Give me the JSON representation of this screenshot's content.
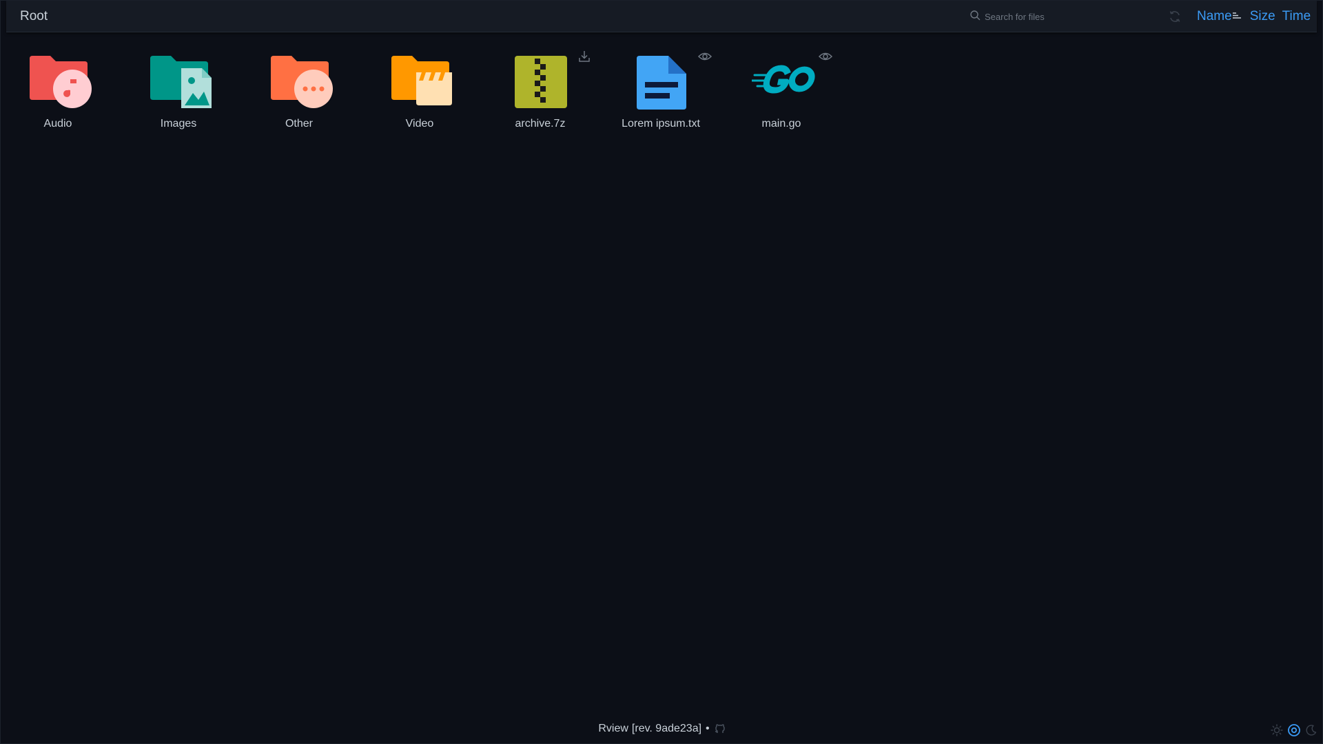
{
  "header": {
    "breadcrumb": "Root",
    "search_placeholder": "Search for files",
    "sort": {
      "name_label": "Name",
      "size_label": "Size",
      "time_label": "Time",
      "active": "name"
    }
  },
  "entries": [
    {
      "name": "Audio",
      "kind": "folder",
      "icon": "folder-audio-icon",
      "color": "#ef5350",
      "badge_color": "#ffcdd2"
    },
    {
      "name": "Images",
      "kind": "folder",
      "icon": "folder-images-icon",
      "color": "#009688",
      "badge_color": "#b2dfdb"
    },
    {
      "name": "Other",
      "kind": "folder",
      "icon": "folder-other-icon",
      "color": "#ff7043",
      "badge_color": "#ffccbc"
    },
    {
      "name": "Video",
      "kind": "folder",
      "icon": "folder-video-icon",
      "color": "#ff9800",
      "badge_color": "#ffe0b2"
    },
    {
      "name": "archive.7z",
      "kind": "file",
      "icon": "zip-file-icon",
      "color": "#afb42b",
      "action": "download-icon"
    },
    {
      "name": "Lorem ipsum.txt",
      "kind": "file",
      "icon": "text-file-icon",
      "color": "#42a5f5",
      "action": "preview-eye-icon"
    },
    {
      "name": "main.go",
      "kind": "file",
      "icon": "go-file-icon",
      "color": "#00acc1",
      "action": "preview-eye-icon"
    }
  ],
  "footer": {
    "app_name": "Rview",
    "revision": "[rev. 9ade23a]",
    "separator": "•"
  },
  "theme": {
    "options": [
      "light-theme-icon",
      "auto-theme-icon",
      "dark-theme-icon"
    ],
    "active": "auto-theme-icon"
  },
  "colors": {
    "background": "#0c0f17",
    "header": "#161b24",
    "accent": "#3b9bf5",
    "text": "#c9d1d9",
    "muted": "#6f7782"
  }
}
